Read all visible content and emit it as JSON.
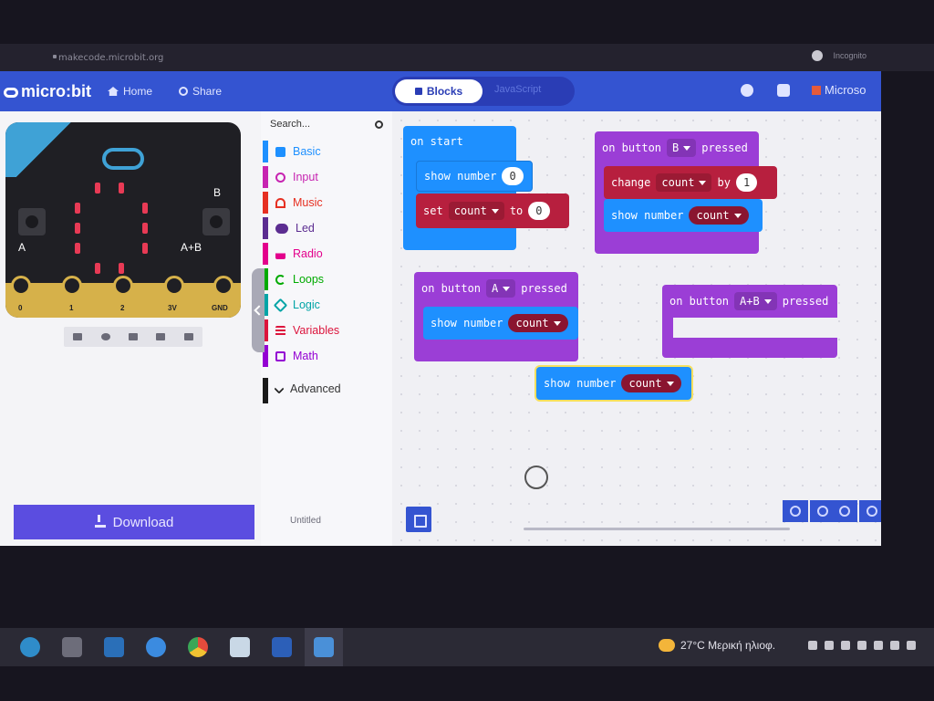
{
  "browser": {
    "url": "makecode.microbit.org",
    "profile_label": "Incognito"
  },
  "menubar": {
    "logo": "micro:bit",
    "home_label": "Home",
    "share_label": "Share",
    "tabs": {
      "blocks": "Blocks",
      "javascript": "JavaScript"
    },
    "brand": "Microso",
    "icons": [
      "help-icon",
      "settings-icon"
    ]
  },
  "simulator": {
    "button_a": "A",
    "button_b": "B",
    "button_ab": "A+B",
    "pins": [
      "0",
      "1",
      "2",
      "3V",
      "GND"
    ],
    "controls": [
      "stop-icon",
      "restart-icon",
      "slow-icon",
      "mute-icon",
      "fullscreen-icon"
    ]
  },
  "toolbox": {
    "search_placeholder": "Search...",
    "categories": [
      {
        "label": "Basic",
        "color": "#1e90ff"
      },
      {
        "label": "Input",
        "color": "#c724b1"
      },
      {
        "label": "Music",
        "color": "#e63022"
      },
      {
        "label": "Led",
        "color": "#5c2d91"
      },
      {
        "label": "Radio",
        "color": "#e3008c"
      },
      {
        "label": "Loops",
        "color": "#00aa00"
      },
      {
        "label": "Logic",
        "color": "#00a4a6"
      },
      {
        "label": "Variables",
        "color": "#dc143c"
      },
      {
        "label": "Math",
        "color": "#9400d3"
      },
      {
        "label": "Advanced",
        "color": "#1a1a1a"
      }
    ]
  },
  "blocks": {
    "on_start": {
      "header": "on start",
      "show_number": "show number",
      "show_value": "0",
      "set": "set",
      "var": "count",
      "to": "to",
      "to_value": "0"
    },
    "on_button_b": {
      "on": "on button",
      "button": "B",
      "pressed": "pressed",
      "change": "change",
      "var": "count",
      "by": "by",
      "by_value": "1",
      "show_number": "show number",
      "show_var": "count"
    },
    "on_button_a": {
      "on": "on button",
      "button": "A",
      "pressed": "pressed",
      "show_number": "show number",
      "show_var": "count"
    },
    "on_button_ab": {
      "on": "on button",
      "button": "A+B",
      "pressed": "pressed"
    },
    "dragging": {
      "show_number": "show number",
      "show_var": "count"
    }
  },
  "footer": {
    "download_label": "Download",
    "project_name": "Untitled"
  },
  "colors": {
    "event": "#9b3ed6",
    "basic": "#1e90ff",
    "variables": "#b71f3e",
    "menubar": "#3454d1"
  },
  "taskbar": {
    "weather": "27°C Μερική ηλιοφ.",
    "apps": [
      "edge-icon",
      "photos-icon",
      "remote-icon",
      "help-icon",
      "chrome-icon",
      "paint-icon",
      "word-icon",
      "photo-viewer-icon"
    ]
  }
}
